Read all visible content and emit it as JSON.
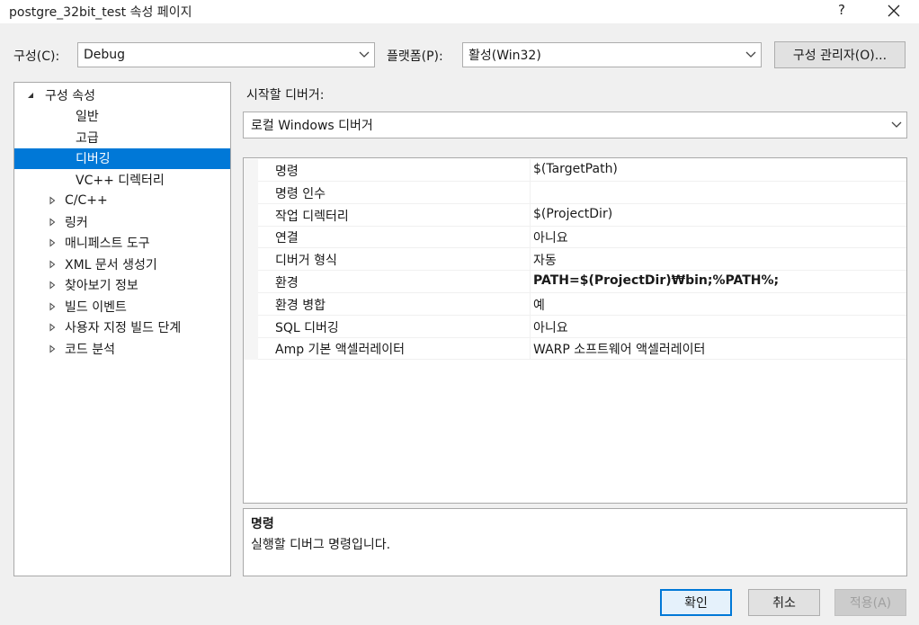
{
  "window": {
    "title": "postgre_32bit_test 속성 페이지",
    "help_label": "?",
    "close_icon": "close-icon"
  },
  "config": {
    "label": "구성(C):",
    "value": "Debug"
  },
  "platform": {
    "label": "플랫폼(P):",
    "value": "활성(Win32)"
  },
  "config_manager_label": "구성 관리자(O)...",
  "tree": {
    "items": [
      {
        "label": "구성 속성",
        "expander": "expanded"
      },
      {
        "label": "일반",
        "expander": ""
      },
      {
        "label": "고급",
        "expander": ""
      },
      {
        "label": "디버깅",
        "expander": "",
        "selected": true
      },
      {
        "label": "VC++ 디렉터리",
        "expander": ""
      },
      {
        "label": "C/C++",
        "expander": "collapsed"
      },
      {
        "label": "링커",
        "expander": "collapsed"
      },
      {
        "label": "매니페스트 도구",
        "expander": "collapsed"
      },
      {
        "label": "XML 문서 생성기",
        "expander": "collapsed"
      },
      {
        "label": "찾아보기 정보",
        "expander": "collapsed"
      },
      {
        "label": "빌드 이벤트",
        "expander": "collapsed"
      },
      {
        "label": "사용자 지정 빌드 단계",
        "expander": "collapsed"
      },
      {
        "label": "코드 분석",
        "expander": "collapsed"
      }
    ]
  },
  "debugger": {
    "label": "시작할 디버거:",
    "value": "로컬 Windows 디버거"
  },
  "properties": [
    {
      "name": "명령",
      "value": "$(TargetPath)",
      "bold": false
    },
    {
      "name": "명령 인수",
      "value": "",
      "bold": false
    },
    {
      "name": "작업 디렉터리",
      "value": "$(ProjectDir)",
      "bold": false
    },
    {
      "name": "연결",
      "value": "아니요",
      "bold": false
    },
    {
      "name": "디버거 형식",
      "value": "자동",
      "bold": false
    },
    {
      "name": "환경",
      "value": "PATH=$(ProjectDir)₩bin;%PATH%;",
      "bold": true
    },
    {
      "name": "환경 병합",
      "value": "예",
      "bold": false
    },
    {
      "name": "SQL 디버깅",
      "value": "아니요",
      "bold": false
    },
    {
      "name": "Amp 기본 액셀러레이터",
      "value": "WARP 소프트웨어 액셀러레이터",
      "bold": false
    }
  ],
  "description": {
    "title": "명령",
    "text": "실행할 디버그 명령입니다."
  },
  "buttons": {
    "ok": "확인",
    "cancel": "취소",
    "apply": "적용(A)"
  },
  "colors": {
    "selection": "#0078d7",
    "dialog_bg": "#f0f0f0"
  }
}
